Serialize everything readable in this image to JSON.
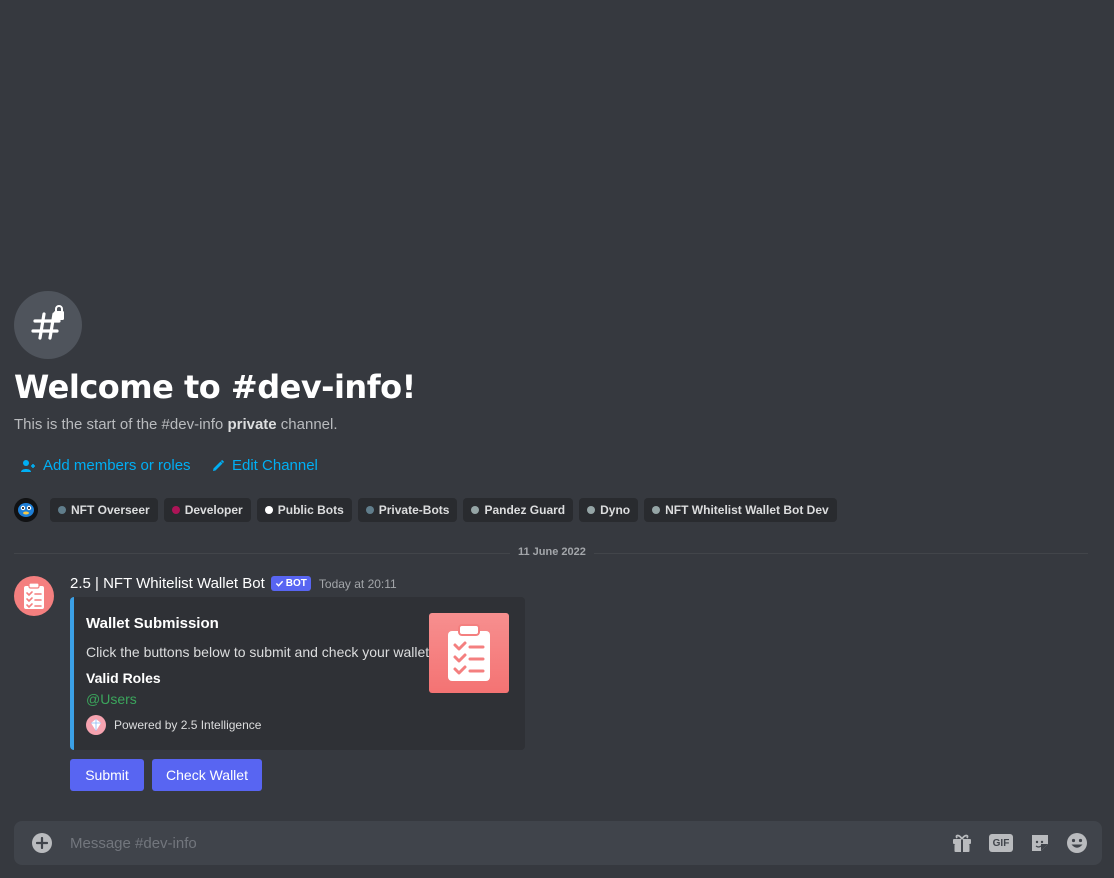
{
  "welcome": {
    "title": "Welcome to #dev-info!",
    "subtitle_prefix": "This is the start of the #dev-info ",
    "subtitle_bold": "private",
    "subtitle_suffix": " channel.",
    "add_members_label": "Add members or roles",
    "edit_channel_label": "Edit Channel"
  },
  "roles": [
    {
      "label": "NFT Overseer",
      "color": "#607d8b"
    },
    {
      "label": "Developer",
      "color": "#ad1457"
    },
    {
      "label": "Public Bots",
      "color": "#ffffff"
    },
    {
      "label": "Private-Bots",
      "color": "#607d8b"
    },
    {
      "label": "Pandez Guard",
      "color": "#95a5a6"
    },
    {
      "label": "Dyno",
      "color": "#95a5a6"
    },
    {
      "label": "NFT Whitelist Wallet Bot Dev",
      "color": "#95a5a6"
    }
  ],
  "divider_date": "11 June 2022",
  "message": {
    "author": "2.5 | NFT Whitelist Wallet Bot",
    "bot_tag": "BOT",
    "timestamp": "Today at 20:11",
    "embed": {
      "accent_color": "#3ba0e6",
      "title": "Wallet Submission",
      "description": "Click the buttons below to submit and check your wallet.",
      "field_name": "Valid Roles",
      "field_value": "@Users",
      "footer": "Powered by 2.5 Intelligence",
      "thumbnail_icon": "clipboard-checklist-icon"
    },
    "buttons": {
      "submit_label": "Submit",
      "check_wallet_label": "Check Wallet"
    }
  },
  "composer": {
    "placeholder": "Message #dev-info",
    "gif_label": "GIF"
  },
  "colors": {
    "background": "#36393f",
    "blurple": "#5865f2",
    "link": "#00aff4",
    "mention_green": "#3ba55c"
  }
}
